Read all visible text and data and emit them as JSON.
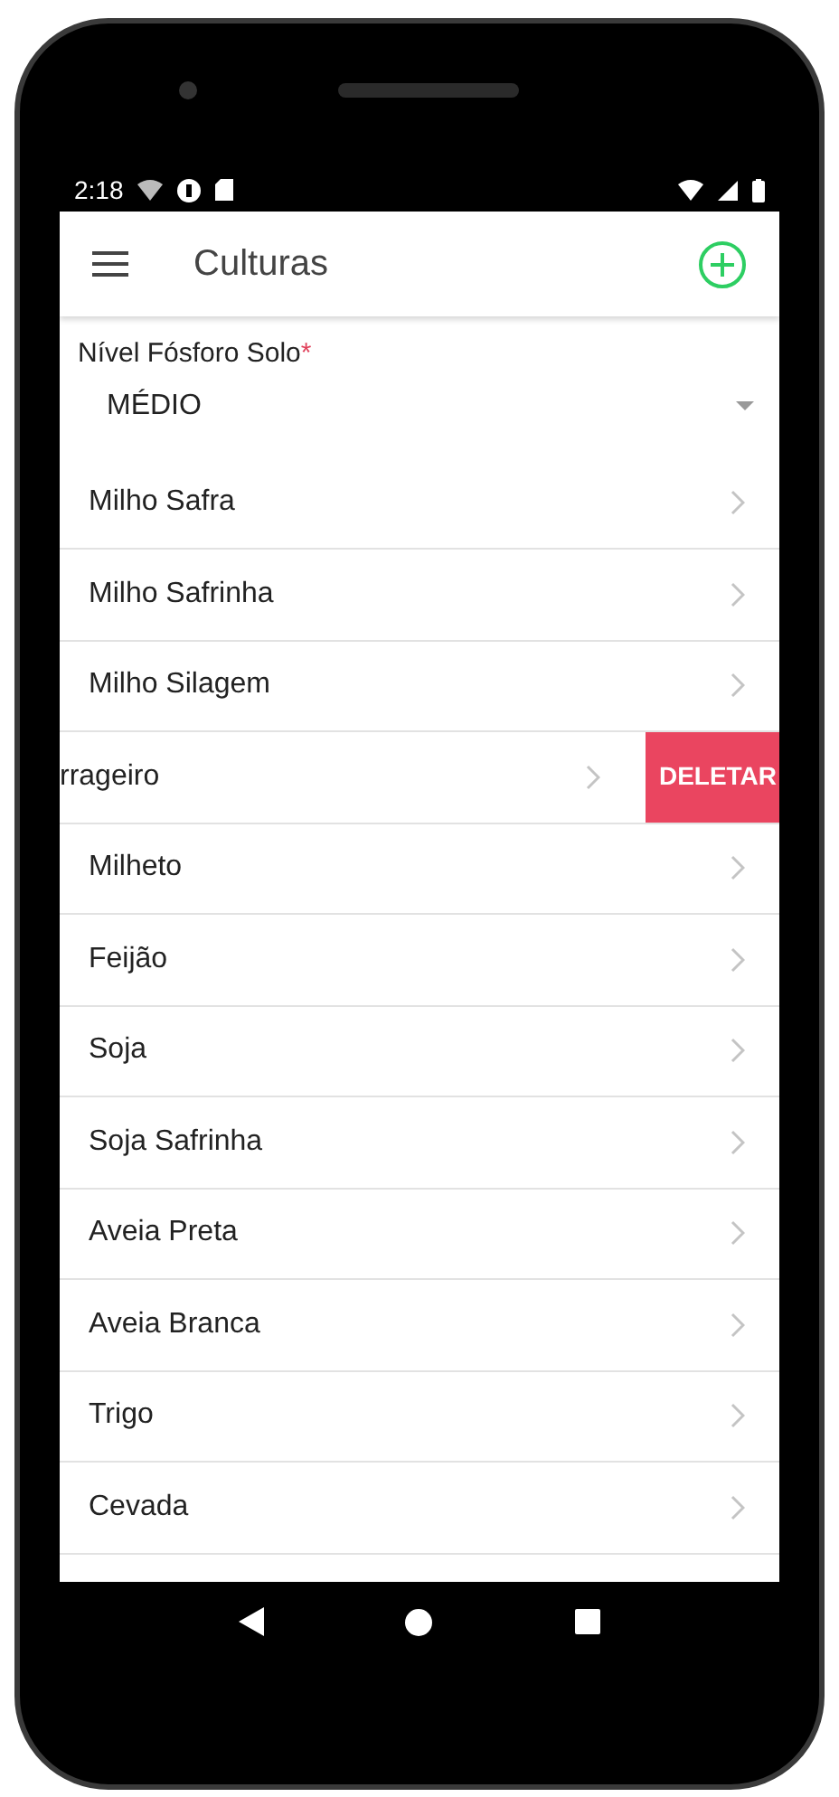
{
  "status_bar": {
    "time": "2:18"
  },
  "app_bar": {
    "title": "Culturas"
  },
  "field": {
    "label": "Nível Fósforo Solo",
    "required_mark": "*",
    "value": "MÉDIO"
  },
  "items": [
    {
      "label": "Milho Safra",
      "swiped": false
    },
    {
      "label": "Milho Safrinha",
      "swiped": false
    },
    {
      "label": "Milho Silagem",
      "swiped": false
    },
    {
      "label": "rrageiro",
      "swiped": true,
      "action": "DELETAR"
    },
    {
      "label": "Milheto",
      "swiped": false
    },
    {
      "label": "Feijão",
      "swiped": false
    },
    {
      "label": "Soja",
      "swiped": false
    },
    {
      "label": "Soja Safrinha",
      "swiped": false
    },
    {
      "label": "Aveia Preta",
      "swiped": false
    },
    {
      "label": "Aveia Branca",
      "swiped": false
    },
    {
      "label": "Trigo",
      "swiped": false
    },
    {
      "label": "Cevada",
      "swiped": false
    }
  ]
}
